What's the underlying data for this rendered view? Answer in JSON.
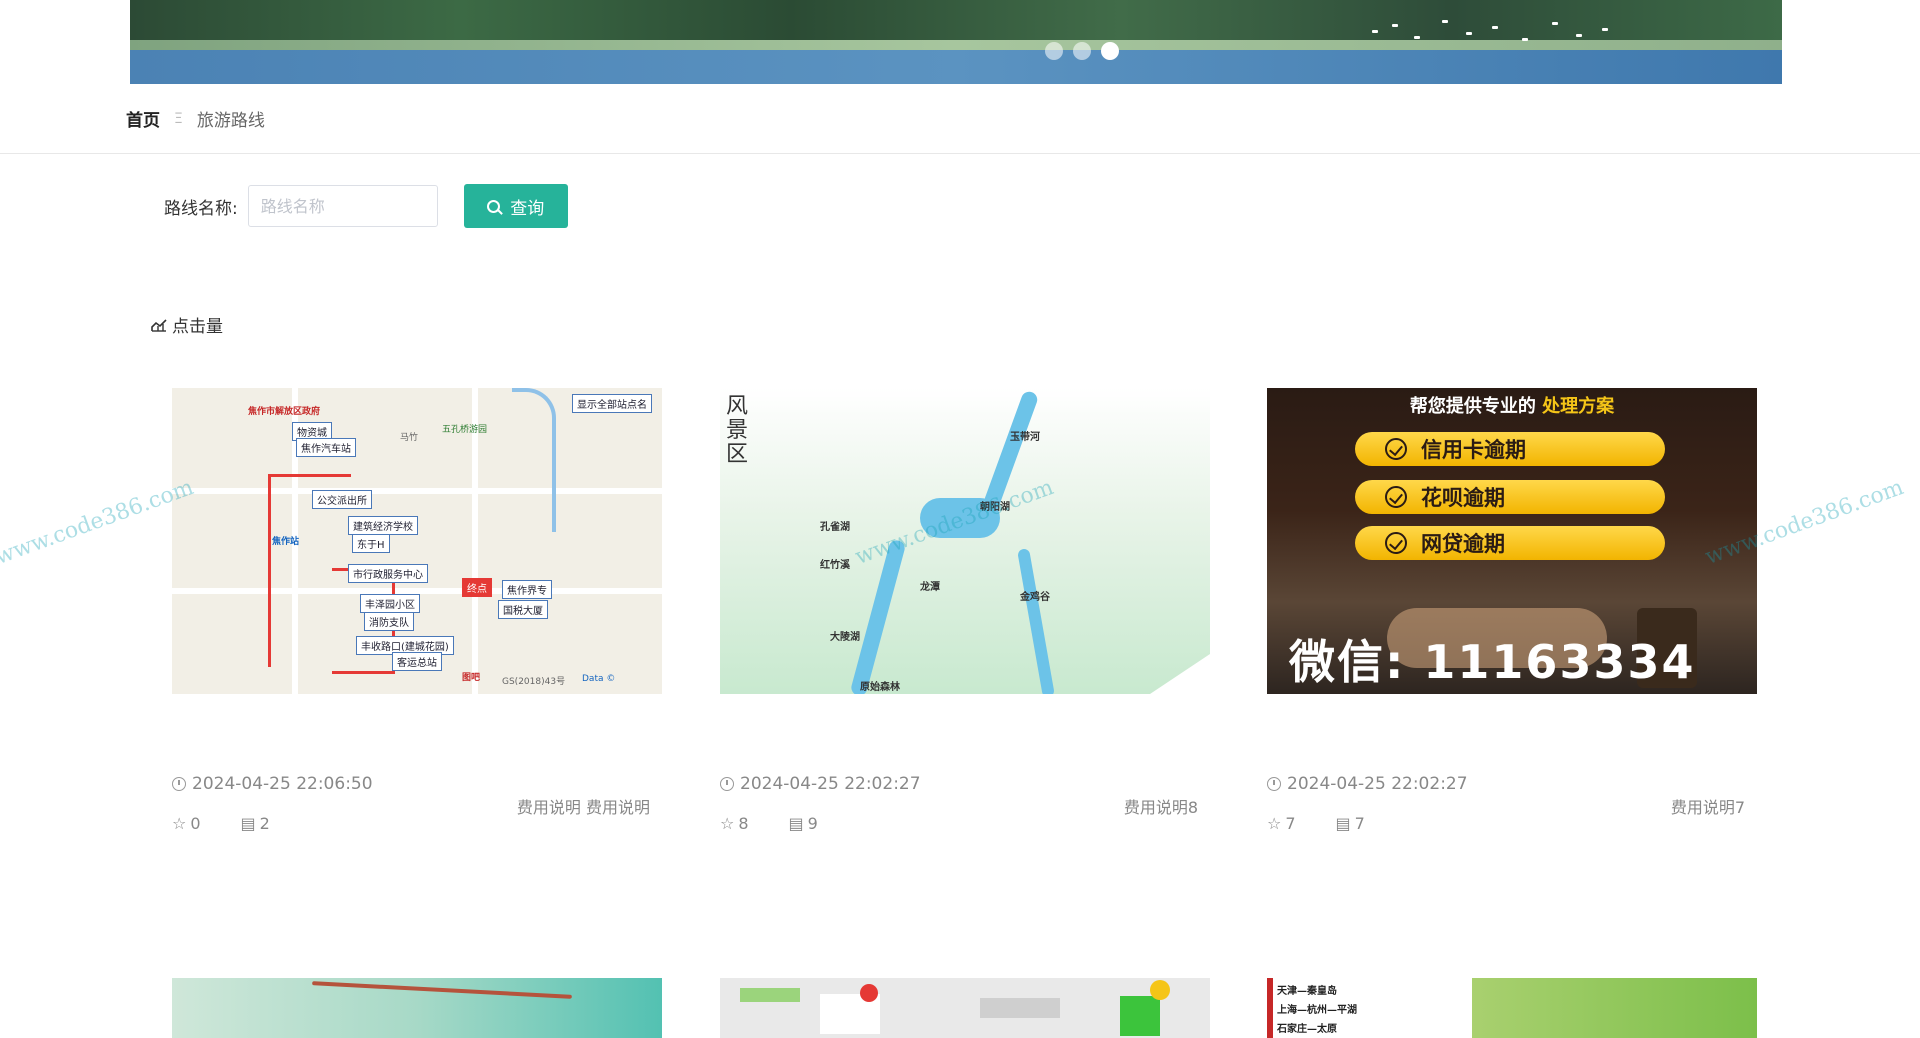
{
  "breadcrumb": {
    "home": "首页",
    "separator": "Ξ",
    "current": "旅游路线"
  },
  "search": {
    "label": "路线名称:",
    "placeholder": "路线名称",
    "value": "",
    "button_label": "查询"
  },
  "sort": {
    "label": "点击量"
  },
  "cards": [
    {
      "date": "2024-04-25 22:06:50",
      "description": "费用说明 费用说明",
      "favorites": "0",
      "views": "2"
    },
    {
      "date": "2024-04-25 22:02:27",
      "description": "费用说明8",
      "favorites": "8",
      "views": "9"
    },
    {
      "date": "2024-04-25 22:02:27",
      "description": "费用说明7",
      "favorites": "7",
      "views": "7"
    }
  ],
  "map1": {
    "labels": [
      "焦作市解放区政府",
      "焦作汽车站",
      "物资城",
      "公交派出所",
      "建筑经济学校",
      "东于H",
      "市行政服务中心",
      "丰泽园小区",
      "消防支队",
      "丰收路口(建城花园)",
      "客运总站",
      "焦作界专",
      "国税大厦",
      "终点",
      "显示全部站点名"
    ],
    "texts": [
      "焦作站",
      "五孔桥游园",
      "马竹",
      "GS(2018)43号",
      "图吧",
      "Data ©"
    ]
  },
  "map2": {
    "texts": [
      "风",
      "景",
      "区",
      "孔雀湖",
      "大陵湖",
      "红竹溪",
      "原始森林",
      "朝阳湖",
      "龙潭",
      "玉带河",
      "金鸡谷"
    ]
  },
  "ad": {
    "header": "帮您提供专业的",
    "header_highlight": "处理方案",
    "items": [
      "信用卡逾期",
      "花呗逾期",
      "网贷逾期"
    ],
    "wechat": "微信: 11163334"
  },
  "bottom": {
    "legend": [
      "天津—秦皇岛",
      "上海—杭州—平湖",
      "石家庄—太原"
    ]
  },
  "watermark": "www.code386.com",
  "colors": {
    "primary": "#26b39a",
    "route": "#e53935",
    "highlight": "#f5c518"
  }
}
